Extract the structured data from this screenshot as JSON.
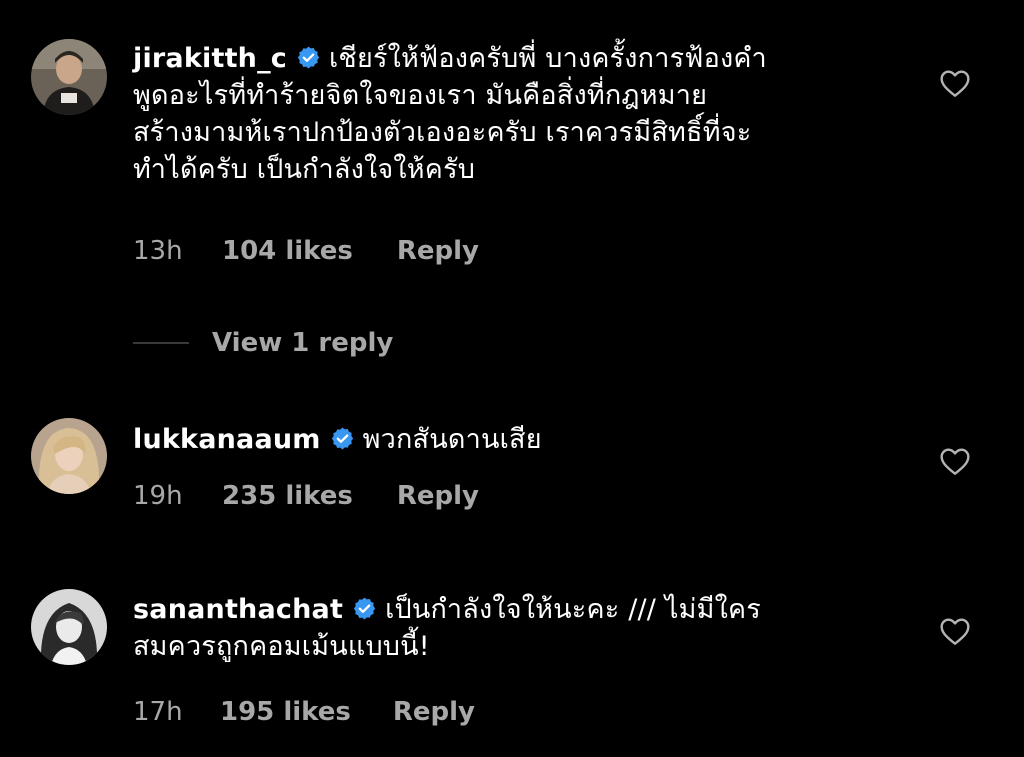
{
  "colors": {
    "background": "#000000",
    "text": "#ffffff",
    "secondary": "#a8a8a8",
    "verified": "#3897f0"
  },
  "comments": [
    {
      "username": "jirakitth_c",
      "verified": true,
      "text": "เชียร์ให้ฟ้องครับพี่ บางครั้งการฟ้องคำพูดอะไรที่ทำร้ายจิตใจของเรา มันคือสิ่งที่กฎหมายสร้างมามห้เราปกป้องตัวเองอะครับ เราควรมีสิทธิ์ที่จะทำได้ครับ เป็นกำลังใจให้ครับ",
      "lines": [
        "เชียร์ให้ฟ้องครับพี่ บางครั้งการฟ้องคำ",
        "พูดอะไรที่ทำร้ายจิตใจของเรา มันคือสิ่งที่กฎหมาย",
        "สร้างมามห้เราปกป้องตัวเองอะครับ เราควรมีสิทธิ์ที่จะ",
        "ทำได้ครับ เป็นกำลังใจให้ครับ"
      ],
      "time": "13h",
      "likes": "104 likes",
      "reply": "Reply",
      "avatar_icon": "avatar-photo",
      "like_icon": "heart-outline-icon"
    },
    {
      "username": "lukkanaaum",
      "verified": true,
      "lines": [
        "พวกสันดานเสีย"
      ],
      "time": "19h",
      "likes": "235 likes",
      "reply": "Reply",
      "avatar_icon": "avatar-photo",
      "like_icon": "heart-outline-icon"
    },
    {
      "username": "sananthachat",
      "verified": true,
      "lines": [
        "เป็นกำลังใจให้นะคะ /// ไม่มีใคร",
        "สมควรถูกคอมเม้นแบบนี้!"
      ],
      "time": "17h",
      "likes": "195 likes",
      "reply": "Reply",
      "avatar_icon": "avatar-photo",
      "like_icon": "heart-outline-icon"
    }
  ],
  "view_replies": {
    "label": "View 1 reply"
  }
}
